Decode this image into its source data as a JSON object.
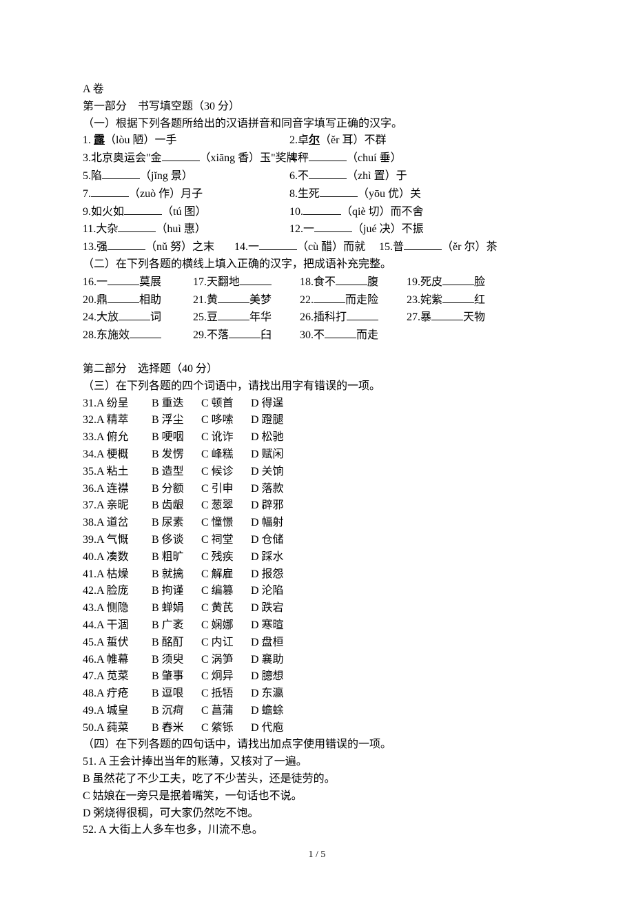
{
  "header": {
    "exam": "A 卷",
    "part1_title": "第一部分　书写填空题（30 分）",
    "sec1_instr": "（一）根据下列各题所给出的汉语拼音和同音字填写正确的汉字。"
  },
  "q1": {
    "num": "1. ",
    "lead": "露",
    "tail": "（lòu 陋）一手"
  },
  "q2": {
    "num": "2.卓",
    "er": "尔",
    "tail": "（ěr 耳）不群"
  },
  "q3": {
    "num": "3.北京奥运会\"金",
    "tail": "（xiāng 香）玉\"奖牌"
  },
  "q4": {
    "num": "4.秤",
    "tail": "（chuí 垂）"
  },
  "q5": {
    "num": "5.陷",
    "tail": "（jǐng 景）"
  },
  "q6": {
    "num": "6.不",
    "tail": "（zhì 置）于"
  },
  "q7": {
    "num": "7.",
    "tail": "（zuò 作）月子"
  },
  "q8": {
    "num": "8.生死",
    "tail": "（yōu 优）关"
  },
  "q9": {
    "num": "9.如火如",
    "tail": "（tú 图）"
  },
  "q10": {
    "num": "10.",
    "tail": "（qiè 切）而不舍"
  },
  "q11": {
    "num": "11.大杂",
    "tail": "（huì 惠）"
  },
  "q12": {
    "num": "12.一",
    "tail": "（jué 决）不振"
  },
  "q13": {
    "num": "13.强",
    "tail": "（nǔ 努）之末"
  },
  "q14": {
    "num": "14.一",
    "tail": "（cù 醋）而就"
  },
  "q15": {
    "num": "15.普",
    "tail": "（ěr 尔）茶"
  },
  "sec2_instr": "（二）在下列各题的横线上填入正确的汉字，把成语补充完整。",
  "q16": {
    "a": "16.一",
    "b": "莫展"
  },
  "q17": {
    "a": "17.天翻地"
  },
  "q18": {
    "a": "18.食不",
    "b": "腹"
  },
  "q19": {
    "a": "19.死皮",
    "b": "脸"
  },
  "q20": {
    "a": "20.鼎",
    "b": "相助"
  },
  "q21": {
    "a": "21.黄",
    "b": "美梦"
  },
  "q22": {
    "a": "22.",
    "b": "而走险"
  },
  "q23": {
    "a": "23.姹紫",
    "b": "红"
  },
  "q24": {
    "a": "24.大放",
    "b": "词"
  },
  "q25": {
    "a": "25.豆",
    "b": "年华"
  },
  "q26": {
    "a": "26.插科打"
  },
  "q27": {
    "a": "27.暴",
    "b": "天物"
  },
  "q28": {
    "a": "28.东施效"
  },
  "q29": {
    "a": "29.不落",
    "b": "臼"
  },
  "q30": {
    "a": "30.不",
    "b": "而走"
  },
  "part2_title": "第二部分　选择题（40 分）",
  "sec3_instr": "（三）在下列各题的四个词语中，请找出用字有错误的一项。",
  "mc": [
    {
      "n": "31.",
      "a": "A 纷呈",
      "b": "B 重迭",
      "c": "C 顿首",
      "d": "D 得逞"
    },
    {
      "n": "32. ",
      "a": "A 精萃",
      "b": "B 浮尘",
      "c": "C 哆嗦",
      "d": "D 蹬腿"
    },
    {
      "n": "33. ",
      "a": "A 俯允",
      "b": "B 哽咽",
      "c": "C 讹诈",
      "d": "D 松驰"
    },
    {
      "n": "34. ",
      "a": "A 梗概",
      "b": "B 发愣",
      "c": "C 峰糕",
      "d": "D 赋闲"
    },
    {
      "n": "35. ",
      "a": "A 粘土",
      "b": "B 造型",
      "c": "C 候诊",
      "d": "D 关饷"
    },
    {
      "n": "36. ",
      "a": "A 连襟",
      "b": "B 分额",
      "c": "C 引申",
      "d": "D 落款"
    },
    {
      "n": "37. ",
      "a": "A 亲昵",
      "b": "B 齿龈",
      "c": "C 葱翠",
      "d": "D 辟邪"
    },
    {
      "n": "38. ",
      "a": "A 道岔",
      "b": "B 尿素",
      "c": "C 憧憬",
      "d": "D 幅射"
    },
    {
      "n": "39. ",
      "a": "A 气慨",
      "b": "B 侈谈",
      "c": "C 祠堂",
      "d": "D 仓储"
    },
    {
      "n": "40. ",
      "a": "A 凑数",
      "b": "B 粗旷",
      "c": "C 残疾",
      "d": "D 踩水"
    },
    {
      "n": "41. ",
      "a": "A 枯燥",
      "b": "B 就擒",
      "c": "C 解雇",
      "d": "D 报怨"
    },
    {
      "n": "42. ",
      "a": "A 脸庞",
      "b": "B 拘谨",
      "c": "C 编篡",
      "d": "D 沦陷"
    },
    {
      "n": "43. ",
      "a": "A 恻隐",
      "b": "B 蝉娟",
      "c": "C 黄芪",
      "d": "D 跌宕"
    },
    {
      "n": "44. ",
      "a": "A 干涸",
      "b": "B 广袤",
      "c": "C 娴娜",
      "d": "D 寒暄"
    },
    {
      "n": "45. ",
      "a": "A 蜇伏",
      "b": "B 酩酊",
      "c": "C 内讧",
      "d": "D 盘桓"
    },
    {
      "n": "46. ",
      "a": "A 帷幕",
      "b": "B 须臾",
      "c": "C 涡笋",
      "d": "D 襄助"
    },
    {
      "n": "47. ",
      "a": "A 苋菜",
      "b": "B 肇事",
      "c": "C 炯异",
      "d": "D 臆想"
    },
    {
      "n": "48. ",
      "a": "A 疔疮",
      "b": "B 逗哏",
      "c": "C 抵牾",
      "d": "D 东瀛"
    },
    {
      "n": "49. ",
      "a": "A 城皇",
      "b": "B 沉疴",
      "c": "C 菖蒲",
      "d": "D 蟾蜍"
    },
    {
      "n": "50. ",
      "a": "A 莼菜",
      "b": "B 舂米",
      "c": "C 綮铄",
      "d": "D 代庖"
    }
  ],
  "sec4_instr": "（四）在下列各题的四句话中，请找出加点字使用错误的一项。",
  "q51": {
    "n": "51. ",
    "a": "A 王会计捧出当年的账薄，又核对了一遍。",
    "b": "B 虽然花了不少工夫，吃了不少苦头，还是徒劳的。",
    "c": "C 姑娘在一旁只是抿着嘴笑，一句话也不说。",
    "d": "D 粥烧得很稠，可大家仍然吃不饱。"
  },
  "q52": {
    "n": "52. ",
    "a": "A 大街上人多车也多，川流不息。"
  },
  "footer": "1 / 5"
}
